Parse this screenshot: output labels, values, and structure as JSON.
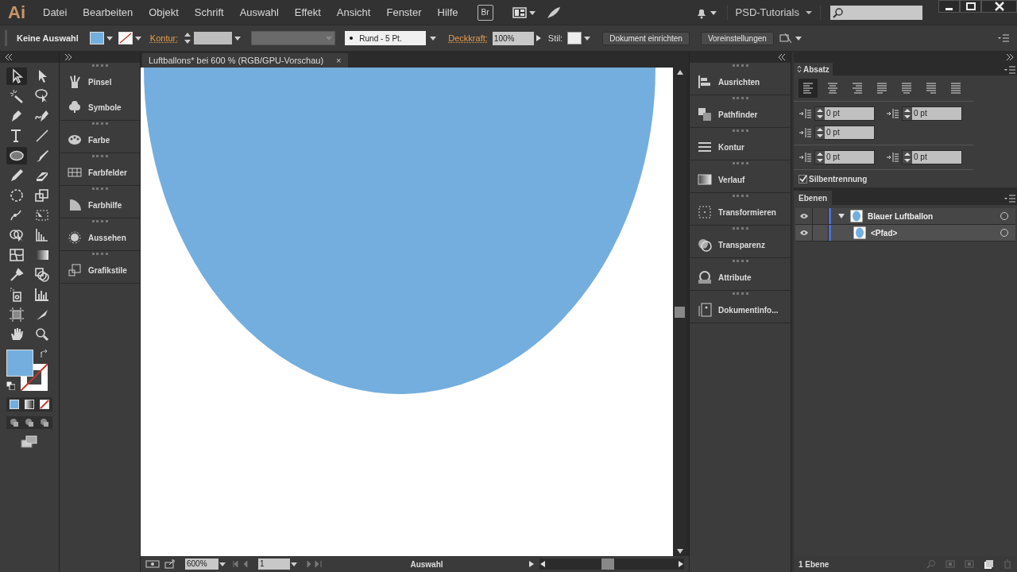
{
  "app_logo": "Ai",
  "menu": [
    "Datei",
    "Bearbeiten",
    "Objekt",
    "Schrift",
    "Auswahl",
    "Effekt",
    "Ansicht",
    "Fenster",
    "Hilfe"
  ],
  "bridge_button": "Br",
  "workspace": "PSD-Tutorials",
  "control_bar": {
    "selection": "Keine Auswahl",
    "stroke_label": "Kontur:",
    "brush": "Rund - 5 Pt.",
    "opacity_label": "Deckkraft:",
    "opacity": "100%",
    "style_label": "Stil:",
    "buttons": [
      "Dokument einrichten",
      "Voreinstellungen"
    ]
  },
  "document_tab": {
    "title": "Luftballons* bei 600 % (RGB/GPU-Vorschau)",
    "close": "×"
  },
  "tools": [
    {
      "selected": true
    },
    {
      "selected": false
    },
    {
      "selected": false
    },
    {
      "selected": false
    },
    {
      "selected": false
    },
    {
      "selected": false
    },
    {
      "selected": false
    },
    {
      "selected": false
    },
    {
      "selected": true
    },
    {
      "selected": false
    },
    {
      "selected": false
    },
    {
      "selected": false
    },
    {
      "selected": false
    },
    {
      "selected": false
    },
    {
      "selected": false
    },
    {
      "selected": false
    },
    {
      "selected": false
    },
    {
      "selected": false
    },
    {
      "selected": false
    },
    {
      "selected": false
    },
    {
      "selected": false
    },
    {
      "selected": false
    },
    {
      "selected": false
    },
    {
      "selected": false
    },
    {
      "selected": false
    },
    {
      "selected": false
    },
    {
      "selected": false
    },
    {
      "selected": false
    }
  ],
  "left_panels": [
    {
      "label": "Pinsel"
    },
    {
      "label": "Symbole"
    },
    {
      "label": "Farbe"
    },
    {
      "label": "Farbfelder"
    },
    {
      "label": "Farbhilfe"
    },
    {
      "label": "Aussehen"
    },
    {
      "label": "Grafikstile"
    }
  ],
  "right_panels": [
    {
      "label": "Ausrichten"
    },
    {
      "label": "Pathfinder"
    },
    {
      "label": "Kontur"
    },
    {
      "label": "Verlauf"
    },
    {
      "label": "Transformieren"
    },
    {
      "label": "Transparenz"
    },
    {
      "label": "Attribute"
    },
    {
      "label": "Dokumentinfo..."
    }
  ],
  "paragraph": {
    "title": "Absatz",
    "alignments": [
      {
        "selected": true
      },
      {
        "selected": false
      },
      {
        "selected": false
      },
      {
        "selected": false
      },
      {
        "selected": false
      },
      {
        "selected": false
      },
      {
        "selected": false
      }
    ],
    "fields": [
      {
        "value": "0 pt"
      },
      {
        "value": "0 pt"
      },
      {
        "value": "0 pt"
      },
      {
        "value": "0 pt"
      },
      {
        "value": "0 pt"
      }
    ],
    "hyphenation": {
      "label": "Silbentrennung",
      "checked": true
    }
  },
  "layers": {
    "title": "Ebenen",
    "items": [
      {
        "name": "Blauer Luftballon",
        "visible": true,
        "expanded": true,
        "children": [
          {
            "name": "<Pfad>",
            "visible": true
          }
        ]
      }
    ]
  },
  "status_bar": {
    "zoom": "600%",
    "artboard": "1",
    "tool": "Auswahl",
    "layer_count": "1 Ebene"
  }
}
